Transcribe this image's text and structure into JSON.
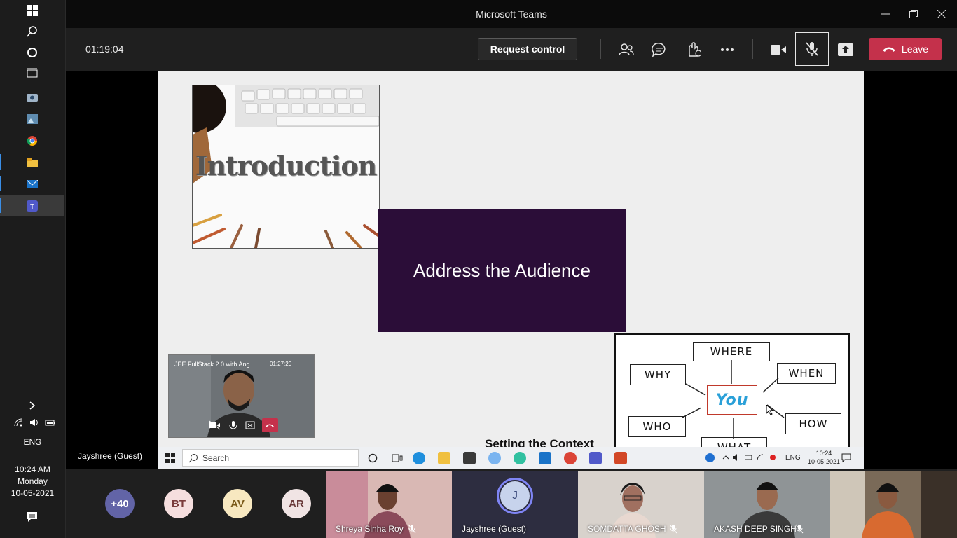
{
  "window": {
    "title": "Microsoft Teams"
  },
  "meeting_bar": {
    "timer": "01:19:04",
    "request_control_label": "Request control",
    "leave_label": "Leave"
  },
  "slide": {
    "intro_image_text": "Introduction",
    "purple_title": "Address the Audience",
    "section_label": "Setting the Context",
    "diagram": {
      "center": "You",
      "labels": [
        "WHERE",
        "WHY",
        "WHEN",
        "WHO",
        "HOW",
        "WHAT"
      ]
    }
  },
  "pip": {
    "title": "JEE FullStack 2.0 with Ang...",
    "time": "01:27:20",
    "more": "..."
  },
  "local_name": "Jayshree (Guest)",
  "inner_taskbar": {
    "search_placeholder": "Search",
    "lang": "ENG",
    "time": "10:24",
    "date": "10-05-2021"
  },
  "system_tray": {
    "lang": "ENG",
    "time": "10:24 AM",
    "day": "Monday",
    "date": "10-05-2021"
  },
  "participants": {
    "overflow": "+40",
    "avatars": [
      "BT",
      "AV",
      "AR"
    ],
    "tiles": [
      {
        "name": "Shreya Sinha Roy"
      },
      {
        "name": "Jayshree (Guest)",
        "initial": "J"
      },
      {
        "name": "SOMDATTA GHOSH"
      },
      {
        "name": "AKASH DEEP SINGH"
      },
      {
        "name": ""
      }
    ]
  },
  "colors": {
    "leave": "#c4314b",
    "slide_purple": "#2b0d38",
    "teams_accent": "#6264a7"
  }
}
